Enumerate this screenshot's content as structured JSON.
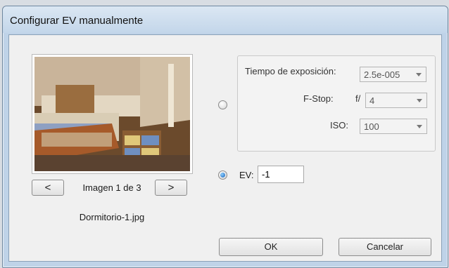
{
  "window": {
    "title": "Configurar EV manualmente"
  },
  "preview": {
    "prev_label": "<",
    "next_label": ">",
    "counter": "Imagen 1 de 3",
    "filename": "Dormitorio-1.jpg"
  },
  "manual": {
    "exposure_label": "Tiempo de exposición:",
    "exposure_value": "2.5e-005",
    "fstop_label": "F-Stop:",
    "fstop_prefix": "f/",
    "fstop_value": "4",
    "iso_label": "ISO:",
    "iso_value": "100",
    "selected": false
  },
  "ev": {
    "label": "EV:",
    "value": "-1",
    "selected": true
  },
  "buttons": {
    "ok": "OK",
    "cancel": "Cancelar"
  },
  "colors": {
    "accent": "#1560b8",
    "frame": "#bfd3e8"
  }
}
